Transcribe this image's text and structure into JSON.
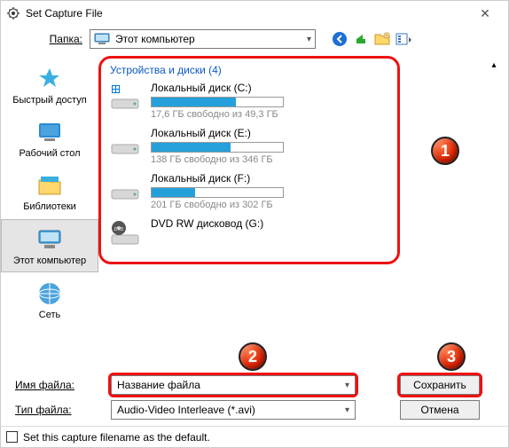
{
  "window": {
    "title": "Set Capture File"
  },
  "folder": {
    "label": "Папка:",
    "value": "Этот компьютер"
  },
  "sidebar": {
    "items": [
      {
        "label": "Быстрый доступ"
      },
      {
        "label": "Рабочий стол"
      },
      {
        "label": "Библиотеки"
      },
      {
        "label": "Этот компьютер"
      },
      {
        "label": "Сеть"
      }
    ]
  },
  "devices": {
    "header": "Устройства и диски (4)",
    "drives": [
      {
        "name": "Локальный диск (C:)",
        "info": "17,6 ГБ свободно из 49,3 ГБ",
        "fill": 64
      },
      {
        "name": "Локальный диск (E:)",
        "info": "138 ГБ свободно из 346 ГБ",
        "fill": 60
      },
      {
        "name": "Локальный диск (F:)",
        "info": "201 ГБ свободно из 302 ГБ",
        "fill": 33
      },
      {
        "name": "DVD RW дисковод (G:)",
        "info": "",
        "fill": -1
      }
    ]
  },
  "badges": {
    "b1": "1",
    "b2": "2",
    "b3": "3"
  },
  "bottom": {
    "filename_label": "Имя файла:",
    "filename_value": "Название файла",
    "filetype_label": "Тип файла:",
    "filetype_value": "Audio-Video Interleave (*.avi)",
    "save": "Сохранить",
    "cancel": "Отмена"
  },
  "default_checkbox": {
    "label": "Set this capture filename as the default."
  }
}
